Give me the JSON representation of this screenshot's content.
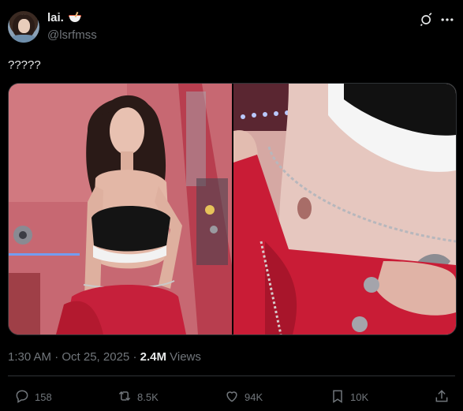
{
  "author": {
    "display_name": "lai.",
    "handle": "@lsrfmss"
  },
  "tweet": {
    "text": "?????",
    "timestamp": "1:30 AM · Oct 25, 2025",
    "views_count": "2.4M",
    "views_label": "Views"
  },
  "actions": {
    "replies": "158",
    "reposts": "8.5K",
    "likes": "94K",
    "bookmarks": "10K"
  },
  "icons": {
    "grok": "grok-icon",
    "more": "more-icon",
    "reply": "reply-icon",
    "repost": "repost-icon",
    "like": "like-icon",
    "bookmark": "bookmark-icon",
    "share": "share-icon"
  },
  "colors": {
    "background": "#000000",
    "text_primary": "#e7e9ea",
    "text_secondary": "#71767b",
    "border": "#2f3336"
  }
}
